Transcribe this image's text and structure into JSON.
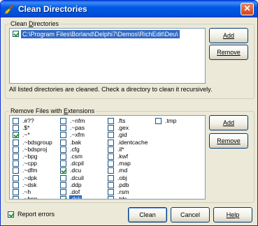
{
  "window": {
    "title": "Clean Directories",
    "close_label": "✕"
  },
  "clean_dirs": {
    "legend_prefix": "Clean ",
    "legend_access": "D",
    "legend_rest": "irectories",
    "dir_items": [
      {
        "path": "C:\\Program Files\\Borland\\Delphi7\\Demos\\RichEdit\\Deu\\",
        "checked": true
      }
    ],
    "add_label": "Add",
    "remove_label": "Remove",
    "info": "All listed directories are cleaned.  Check a directory to clean it recursively."
  },
  "extensions": {
    "legend_prefix": "Remove Files with ",
    "legend_access": "E",
    "legend_rest": "xtensions",
    "columns": [
      [
        {
          "label": ".#??",
          "checked": false
        },
        {
          "label": ".$*",
          "checked": false
        },
        {
          "label": ".~*",
          "checked": true
        },
        {
          "label": ".~bdsgroup",
          "checked": false
        },
        {
          "label": ".~bdsproj",
          "checked": false
        },
        {
          "label": ".~bpg",
          "checked": false
        },
        {
          "label": ".~cpp",
          "checked": false
        },
        {
          "label": ".~dfm",
          "checked": false
        },
        {
          "label": ".~dpk",
          "checked": false
        },
        {
          "label": ".~dsk",
          "checked": false
        },
        {
          "label": ".~h",
          "checked": false
        },
        {
          "label": ".~hpp",
          "checked": false
        }
      ],
      [
        {
          "label": ".~nfm",
          "checked": false
        },
        {
          "label": ".~pas",
          "checked": false
        },
        {
          "label": ".~xfm",
          "checked": false
        },
        {
          "label": ".bak",
          "checked": false
        },
        {
          "label": ".cfg",
          "checked": false
        },
        {
          "label": ".csm",
          "checked": false
        },
        {
          "label": ".dcpil",
          "checked": false
        },
        {
          "label": ".dcu",
          "checked": true
        },
        {
          "label": ".dcuil",
          "checked": false
        },
        {
          "label": ".ddp",
          "checked": false
        },
        {
          "label": ".dof",
          "checked": false
        },
        {
          "label": ".dsk",
          "checked": true,
          "selected": true
        }
      ],
      [
        {
          "label": ".fts",
          "checked": false
        },
        {
          "label": ".gex",
          "checked": false
        },
        {
          "label": ".gid",
          "checked": false
        },
        {
          "label": ".identcache",
          "checked": false
        },
        {
          "label": ".il*",
          "checked": false
        },
        {
          "label": ".kwf",
          "checked": false
        },
        {
          "label": ".map",
          "checked": false
        },
        {
          "label": ".md",
          "checked": false
        },
        {
          "label": ".obj",
          "checked": false
        },
        {
          "label": ".pdb",
          "checked": false
        },
        {
          "label": ".rsm",
          "checked": false
        },
        {
          "label": ".tds",
          "checked": false
        }
      ],
      [
        {
          "label": ".tmp",
          "checked": false
        }
      ]
    ],
    "add_label": "Add",
    "remove_label": "Remove"
  },
  "footer": {
    "report_errors_label": "Report errors",
    "report_errors_checked": true,
    "clean_label": "Clean",
    "cancel_label": "Cancel",
    "help_label": "Help"
  }
}
